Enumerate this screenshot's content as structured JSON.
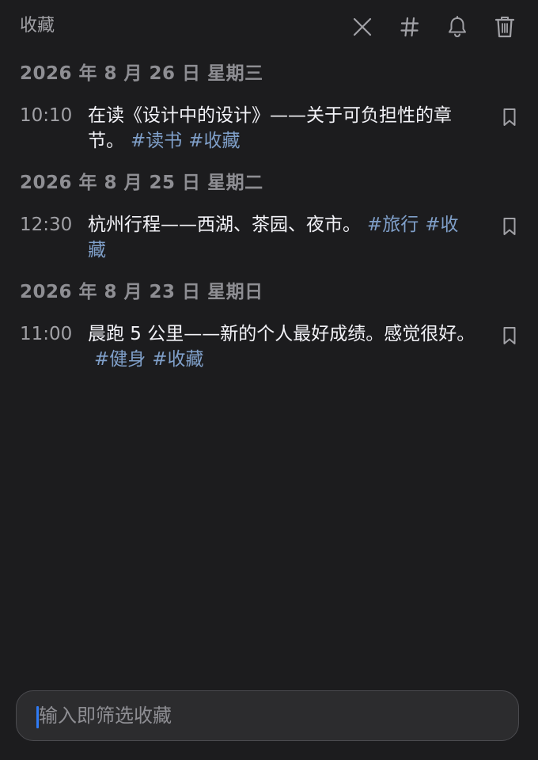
{
  "header": {
    "title": "收藏",
    "icons": [
      "close-icon",
      "hashtag-icon",
      "bell-icon",
      "trash-icon"
    ]
  },
  "days": [
    {
      "heading": "2026 年 8 月 26 日 星期三",
      "entries": [
        {
          "time": "10:10",
          "text": "在读《设计中的设计》——关于可负担性的章节。",
          "tags": [
            "#读书",
            "#收藏"
          ]
        }
      ]
    },
    {
      "heading": "2026 年 8 月 25 日 星期二",
      "entries": [
        {
          "time": "12:30",
          "text": "杭州行程——西湖、茶园、夜市。",
          "tags": [
            "#旅行",
            "#收藏"
          ]
        }
      ]
    },
    {
      "heading": "2026 年 8 月 23 日 星期日",
      "entries": [
        {
          "time": "11:00",
          "text": "晨跑 5 公里——新的个人最好成绩。感觉很好。",
          "tags": [
            "#健身",
            "#收藏"
          ]
        }
      ]
    }
  ],
  "filter": {
    "placeholder": "输入即筛选收藏",
    "value": ""
  },
  "colors": {
    "background": "#1c1c1e",
    "tag": "#7f9fc9",
    "caret": "#2f7bf5"
  }
}
